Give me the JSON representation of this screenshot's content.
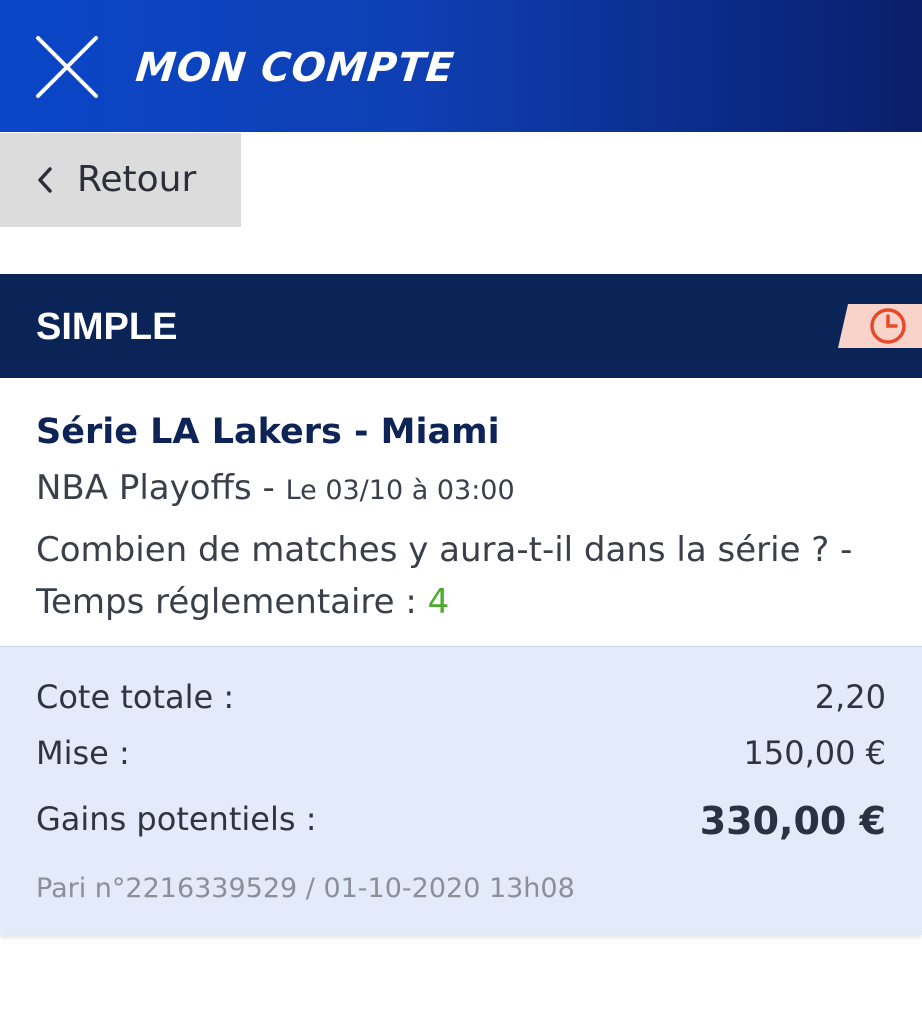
{
  "header": {
    "title": "MON COMPTE",
    "close_icon": "close-icon",
    "background_colors": [
      "#0a46c8",
      "#0a1f6a"
    ]
  },
  "nav": {
    "back_label": "Retour",
    "back_icon": "chevron-left-icon"
  },
  "bet": {
    "type": "SIMPLE",
    "status_icon": "clock-icon",
    "status_color": "#e8492a",
    "event_title": "Série LA Lakers - Miami",
    "competition": "NBA Playoffs",
    "separator": " - ",
    "event_date": "Le 03/10 à 03:00",
    "market": "Combien de matches y aura-t-il dans la série ? - Temps réglementaire : ",
    "pick": "4",
    "pick_color": "#4caa2c"
  },
  "summary": {
    "odds_label": "Cote totale :",
    "odds_value": "2,20",
    "stake_label": "Mise :",
    "stake_value": "150,00 €",
    "gains_label": "Gains potentiels :",
    "gains_value": "330,00 €",
    "reference": "Pari n°2216339529 / 01-10-2020 13h08"
  }
}
